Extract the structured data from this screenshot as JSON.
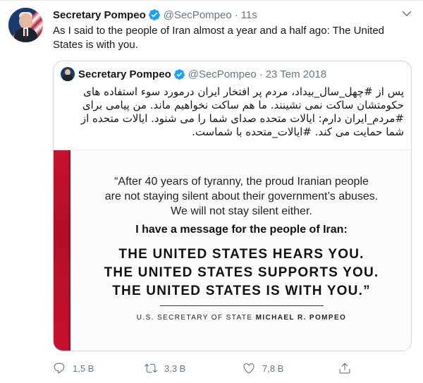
{
  "tweet": {
    "author_name": "Secretary Pompeo",
    "handle": "@SecPompeo",
    "separator": "·",
    "time": "11s",
    "text": "As I said to the people of Iran almost a year and a half ago: The United States is with you."
  },
  "quoted_tweet": {
    "author_name": "Secretary Pompeo",
    "handle": "@SecPompeo",
    "separator": "·",
    "date": "23 Tem 2018",
    "text": "پس از #چهل_سال_بیداد، مردم پر افتخار ایران درمورد سوء استفاده های حکومتشان ساکت نمی نشینند. ما هم ساکت نخواهیم ماند. من پیامی برای #مردم_ایران دارم: ایالات متحده صدای شما را می شنود. ایالات متحده از شما حمایت می کند. #ایالات_متحده با شماست.",
    "image": {
      "quote_line1": "“After 40 years of tyranny, the proud Iranian people",
      "quote_line2": "are not staying silent about their government’s abuses.",
      "quote_line3": "We will not stay silent either.",
      "message": "I have a message for the people of Iran:",
      "caps_line1": "THE UNITED STATES HEARS YOU.",
      "caps_line2": "THE UNITED STATES SUPPORTS YOU.",
      "caps_line3": "THE UNITED STATES IS WITH YOU.”",
      "signature_prefix": "U.S. SECRETARY OF STATE",
      "signature_name": "MICHAEL R. POMPEO"
    }
  },
  "actions": {
    "reply_count": "1,5 B",
    "retweet_count": "3,3 B",
    "like_count": "7,8 B"
  },
  "colors": {
    "accent": "#1da1f2",
    "muted": "#657786",
    "border": "#ccd6dd",
    "flag_red": "#c8102e"
  },
  "icons": [
    "verified-badge-icon",
    "chevron-down-icon",
    "reply-icon",
    "retweet-icon",
    "like-icon",
    "share-icon"
  ]
}
